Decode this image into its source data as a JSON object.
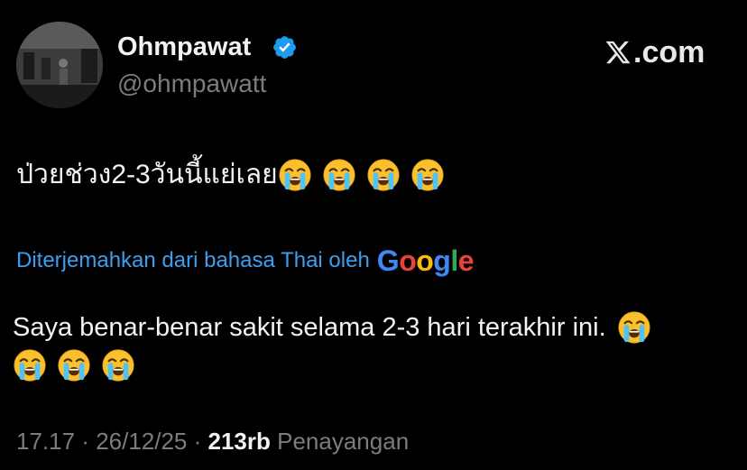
{
  "author": {
    "display_name": "Ohmpawat",
    "handle": "@ohmpawatt",
    "avatar_icon": "profile-photo",
    "verified_icon": "verified-badge-icon",
    "verified_color": "#1d9bf0"
  },
  "site": {
    "label": ".com",
    "logo_icon": "x-logo-icon"
  },
  "tweet": {
    "text": "ป่วยช่วง2-3วันนี้แย่เลย",
    "emojis": [
      "loudly-crying-face",
      "loudly-crying-face",
      "loudly-crying-face",
      "loudly-crying-face"
    ]
  },
  "translation": {
    "label": "Diterjemahkan dari bahasa Thai oleh",
    "provider": "Google",
    "text": "Saya benar-benar sakit selama 2-3 hari terakhir ini.",
    "emojis": [
      "loudly-crying-face",
      "loudly-crying-face",
      "loudly-crying-face",
      "loudly-crying-face"
    ]
  },
  "meta": {
    "time": "17.17",
    "sep1": " · ",
    "date": "26/12/25",
    "sep2": " · ",
    "views": "213rb",
    "views_label": " Penayangan"
  },
  "colors": {
    "background": "#000000",
    "link": "#3b9ff0",
    "muted": "#787d82",
    "text": "#f2f2f2"
  }
}
